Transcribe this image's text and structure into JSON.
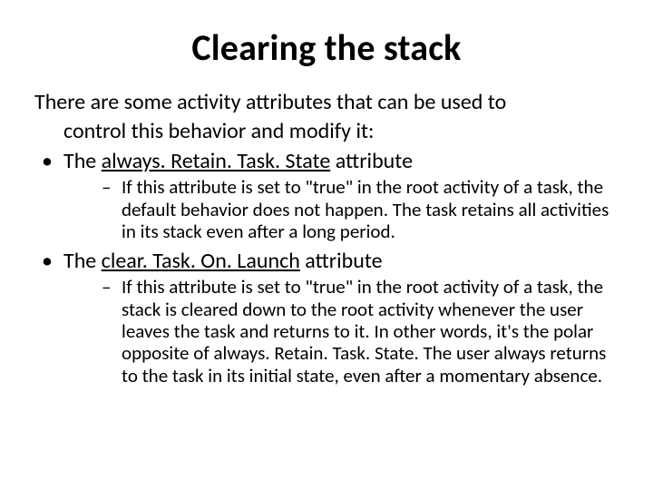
{
  "title": "Clearing the stack",
  "intro_line1": "There are some activity attributes that can be used to",
  "intro_line2": "control this behavior and modify it:",
  "bullets": [
    {
      "prefix": "The ",
      "link": "always. Retain. Task. State",
      "suffix": " attribute",
      "sub": "If this attribute is set to \"true\" in the root activity of a task, the default behavior does not happen. The task retains all activities in its stack even after a long period."
    },
    {
      "prefix": "The ",
      "link": "clear. Task. On. Launch",
      "suffix": " attribute",
      "sub": "If this attribute is set to \"true\" in the root activity of a task, the stack is cleared down to the root activity whenever the user leaves the task and returns to it. In other words, it's the polar opposite of always. Retain. Task. State. The user always returns to the task in its initial state, even after a momentary absence."
    }
  ]
}
